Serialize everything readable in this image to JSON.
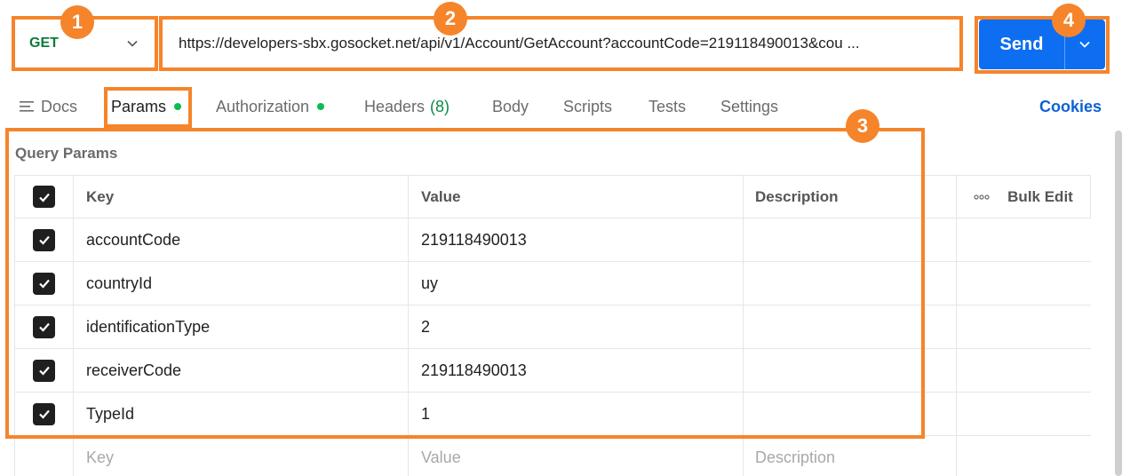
{
  "request": {
    "method": "GET",
    "url": "https://developers-sbx.gosocket.net/api/v1/Account/GetAccount?accountCode=219118490013&cou ...",
    "send_label": "Send"
  },
  "tabs": {
    "docs": "Docs",
    "params": "Params",
    "authorization": "Authorization",
    "headers": "Headers",
    "headers_count": "(8)",
    "body": "Body",
    "scripts": "Scripts",
    "tests": "Tests",
    "settings": "Settings",
    "cookies": "Cookies"
  },
  "query_params": {
    "title": "Query Params",
    "columns": {
      "key": "Key",
      "value": "Value",
      "description": "Description",
      "bulk_edit": "Bulk Edit"
    },
    "rows": [
      {
        "checked": true,
        "key": "accountCode",
        "value": "219118490013",
        "description": ""
      },
      {
        "checked": true,
        "key": "countryId",
        "value": "uy",
        "description": ""
      },
      {
        "checked": true,
        "key": "identificationType",
        "value": "2",
        "description": ""
      },
      {
        "checked": true,
        "key": "receiverCode",
        "value": "219118490013",
        "description": ""
      },
      {
        "checked": true,
        "key": "TypeId",
        "value": "1",
        "description": ""
      }
    ],
    "placeholder": {
      "key": "Key",
      "value": "Value",
      "description": "Description"
    }
  },
  "annotations": {
    "badge_1": "1",
    "badge_2": "2",
    "badge_3": "3",
    "badge_4": "4",
    "highlight_color": "#f5842a"
  },
  "colors": {
    "send_button": "#0d6ef1",
    "method_get": "#0c7a3d",
    "status_dot": "#0cbb52",
    "cookies_link": "#0d62d4"
  }
}
